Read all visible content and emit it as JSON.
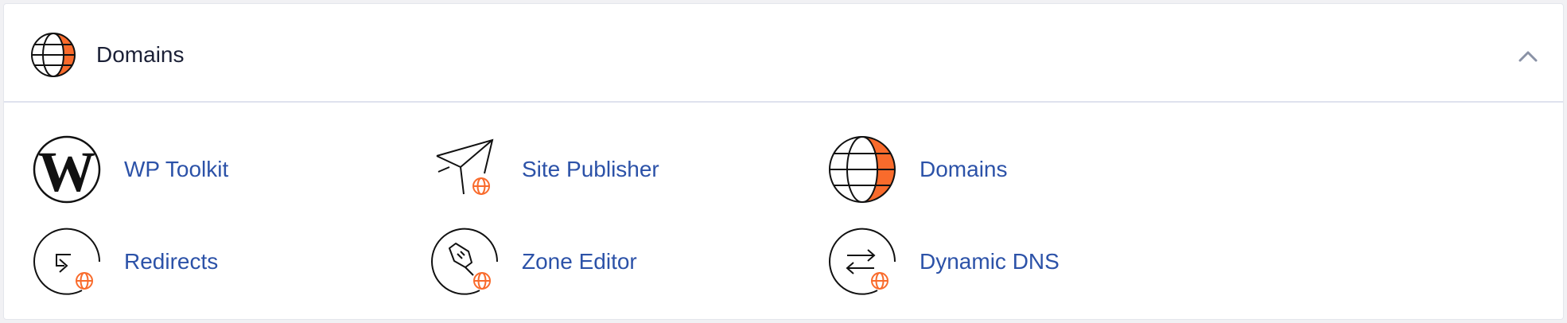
{
  "section": {
    "title": "Domains",
    "header_icon": "globe-icon",
    "collapse_icon": "chevron-up-icon"
  },
  "tools": [
    {
      "label": "WP Toolkit",
      "icon": "wordpress-icon"
    },
    {
      "label": "Site Publisher",
      "icon": "paper-plane-globe-icon"
    },
    {
      "label": "Domains",
      "icon": "globe-icon"
    },
    {
      "label": "Redirects",
      "icon": "redirect-arrow-globe-icon"
    },
    {
      "label": "Zone Editor",
      "icon": "pen-globe-icon"
    },
    {
      "label": "Dynamic DNS",
      "icon": "swap-arrows-globe-icon"
    }
  ],
  "colors": {
    "accent": "#f96b2c",
    "link": "#2c52a8",
    "text": "#1b2036",
    "divider": "#dfe2ee"
  }
}
